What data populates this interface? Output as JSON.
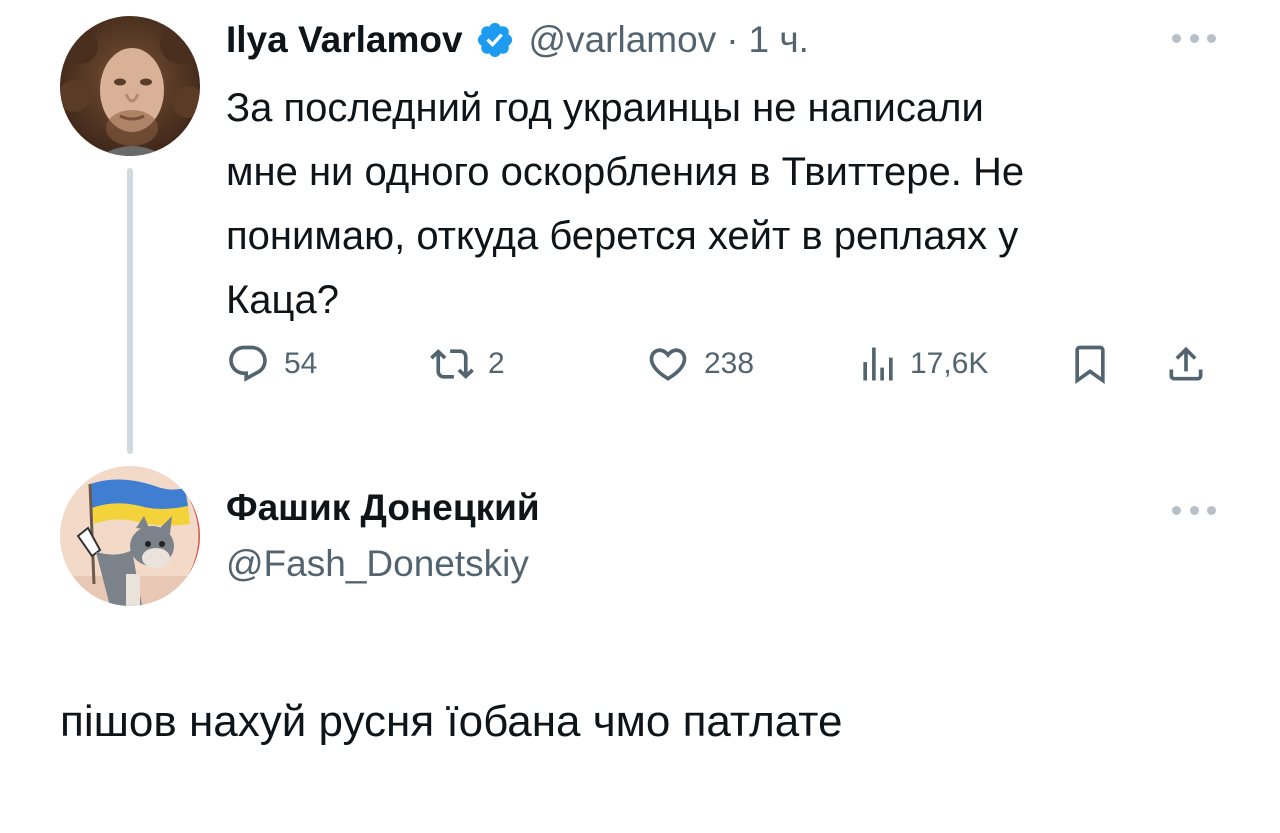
{
  "tweet": {
    "author": {
      "display_name": "Ilya Varlamov",
      "handle": "@varlamov",
      "separator": "·",
      "time": "1 ч.",
      "verified": true,
      "avatar_icon": "avatar-portrait"
    },
    "text": "За последний год украинцы не написали\nмне ни одного оскорбления в Твиттере. Не\nпонимаю, откуда берется хейт в реплаях у\nКаца?",
    "actions": {
      "replies": "54",
      "retweets": "2",
      "likes": "238",
      "views": "17,6K"
    }
  },
  "reply": {
    "author": {
      "display_name": "Фашик Донецкий",
      "handle": "@Fash_Donetskiy",
      "avatar_icon": "avatar-cartoon-cat-flag"
    },
    "text": "пішов нахуй русня їобана чмо патлате"
  },
  "colors": {
    "text_primary": "#0f1419",
    "text_secondary": "#536471",
    "verified_blue": "#1d9bf0",
    "thread_line": "#cfd9de",
    "more_dots": "#b7c0c7"
  }
}
